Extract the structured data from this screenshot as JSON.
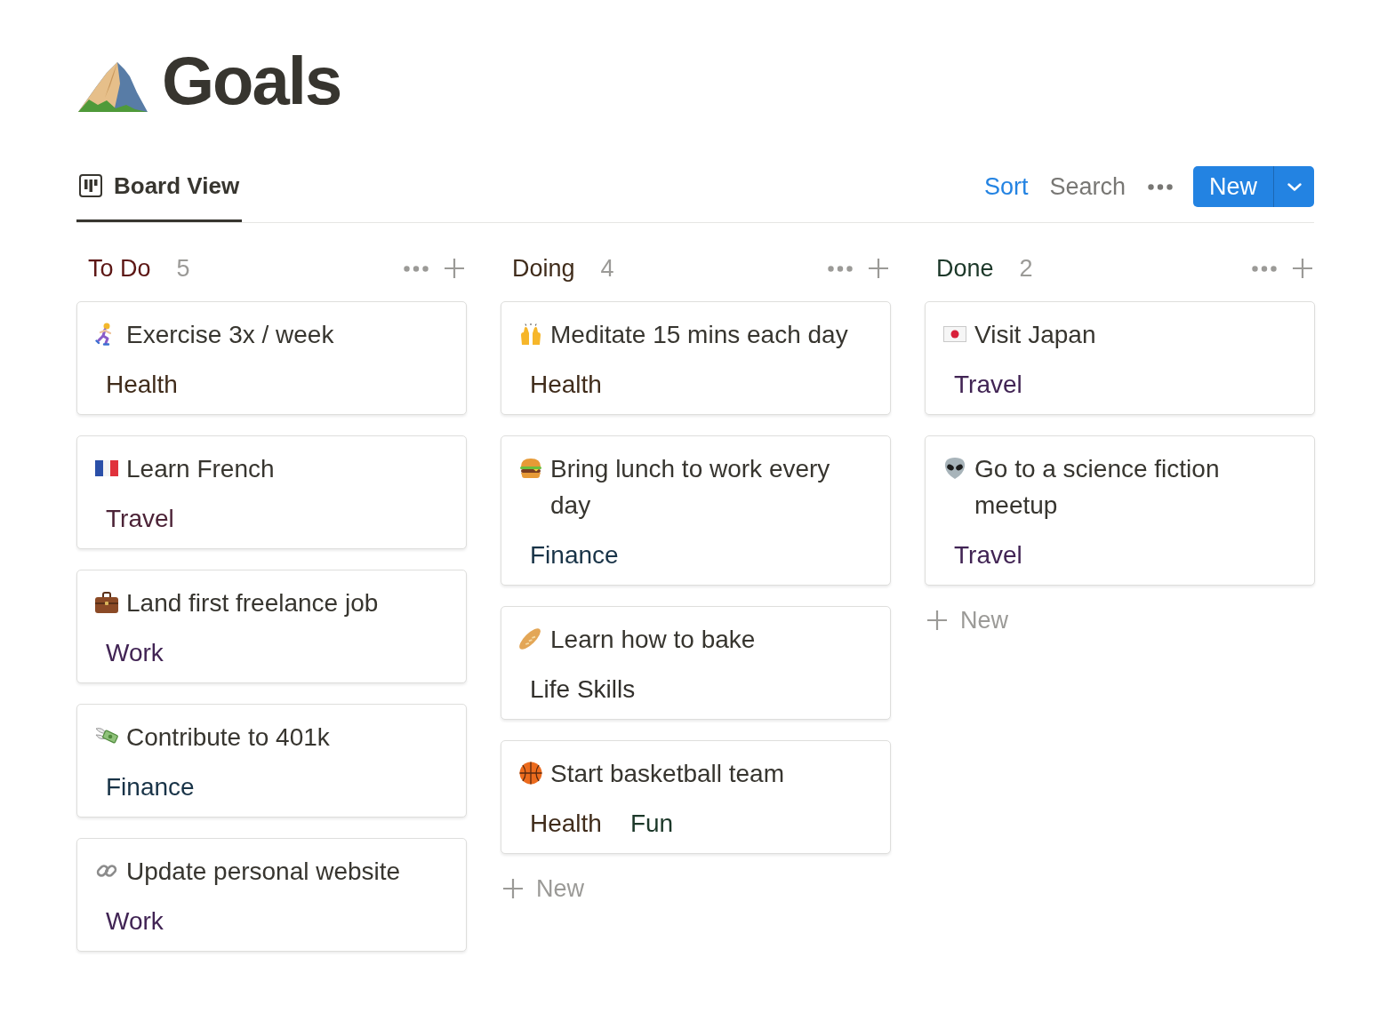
{
  "page": {
    "title": "Goals"
  },
  "views": [
    {
      "label": "Board View",
      "selected": true
    }
  ],
  "toolbar": {
    "actions": [
      {
        "label": "Sort",
        "active": true
      },
      {
        "label": "Search",
        "active": false
      }
    ],
    "new_button": "New"
  },
  "columns": [
    {
      "title": "To Do",
      "color": "#5d1715",
      "count": "5",
      "cards": [
        {
          "title": "Exercise 3x / week",
          "tags": [
            {
              "label": "Health",
              "color": "#402c1b"
            }
          ]
        },
        {
          "title": "Learn French",
          "tags": [
            {
              "label": "Travel",
              "color": "#4c2337"
            }
          ]
        },
        {
          "title": "Land first freelance job",
          "tags": [
            {
              "label": "Work",
              "color": "#412454"
            }
          ]
        },
        {
          "title": "Contribute to 401k",
          "tags": [
            {
              "label": "Finance",
              "color": "#183347"
            }
          ]
        },
        {
          "title": "Update personal website",
          "tags": [
            {
              "label": "Work",
              "color": "#412454"
            }
          ]
        }
      ]
    },
    {
      "title": "Doing",
      "color": "#402c1b",
      "count": "4",
      "cards": [
        {
          "title": "Meditate 15 mins each day",
          "tags": [
            {
              "label": "Health",
              "color": "#402c1b"
            }
          ]
        },
        {
          "title": "Bring lunch to work every day",
          "tags": [
            {
              "label": "Finance",
              "color": "#183347"
            }
          ]
        },
        {
          "title": "Learn how to bake",
          "tags": [
            {
              "label": "Life Skills",
              "color": "#32302c"
            }
          ]
        },
        {
          "title": "Start basketball team",
          "tags": [
            {
              "label": "Health",
              "color": "#402c1b"
            },
            {
              "label": "Fun",
              "color": "#1c3829"
            }
          ]
        }
      ],
      "new_label": "New"
    },
    {
      "title": "Done",
      "color": "#1c3829",
      "count": "2",
      "cards": [
        {
          "title": "Visit Japan",
          "tags": [
            {
              "label": "Travel",
              "color": "#412454"
            }
          ]
        },
        {
          "title": "Go to a science fiction meetup",
          "tags": [
            {
              "label": "Travel",
              "color": "#412454"
            }
          ]
        }
      ],
      "new_label": "New"
    }
  ]
}
